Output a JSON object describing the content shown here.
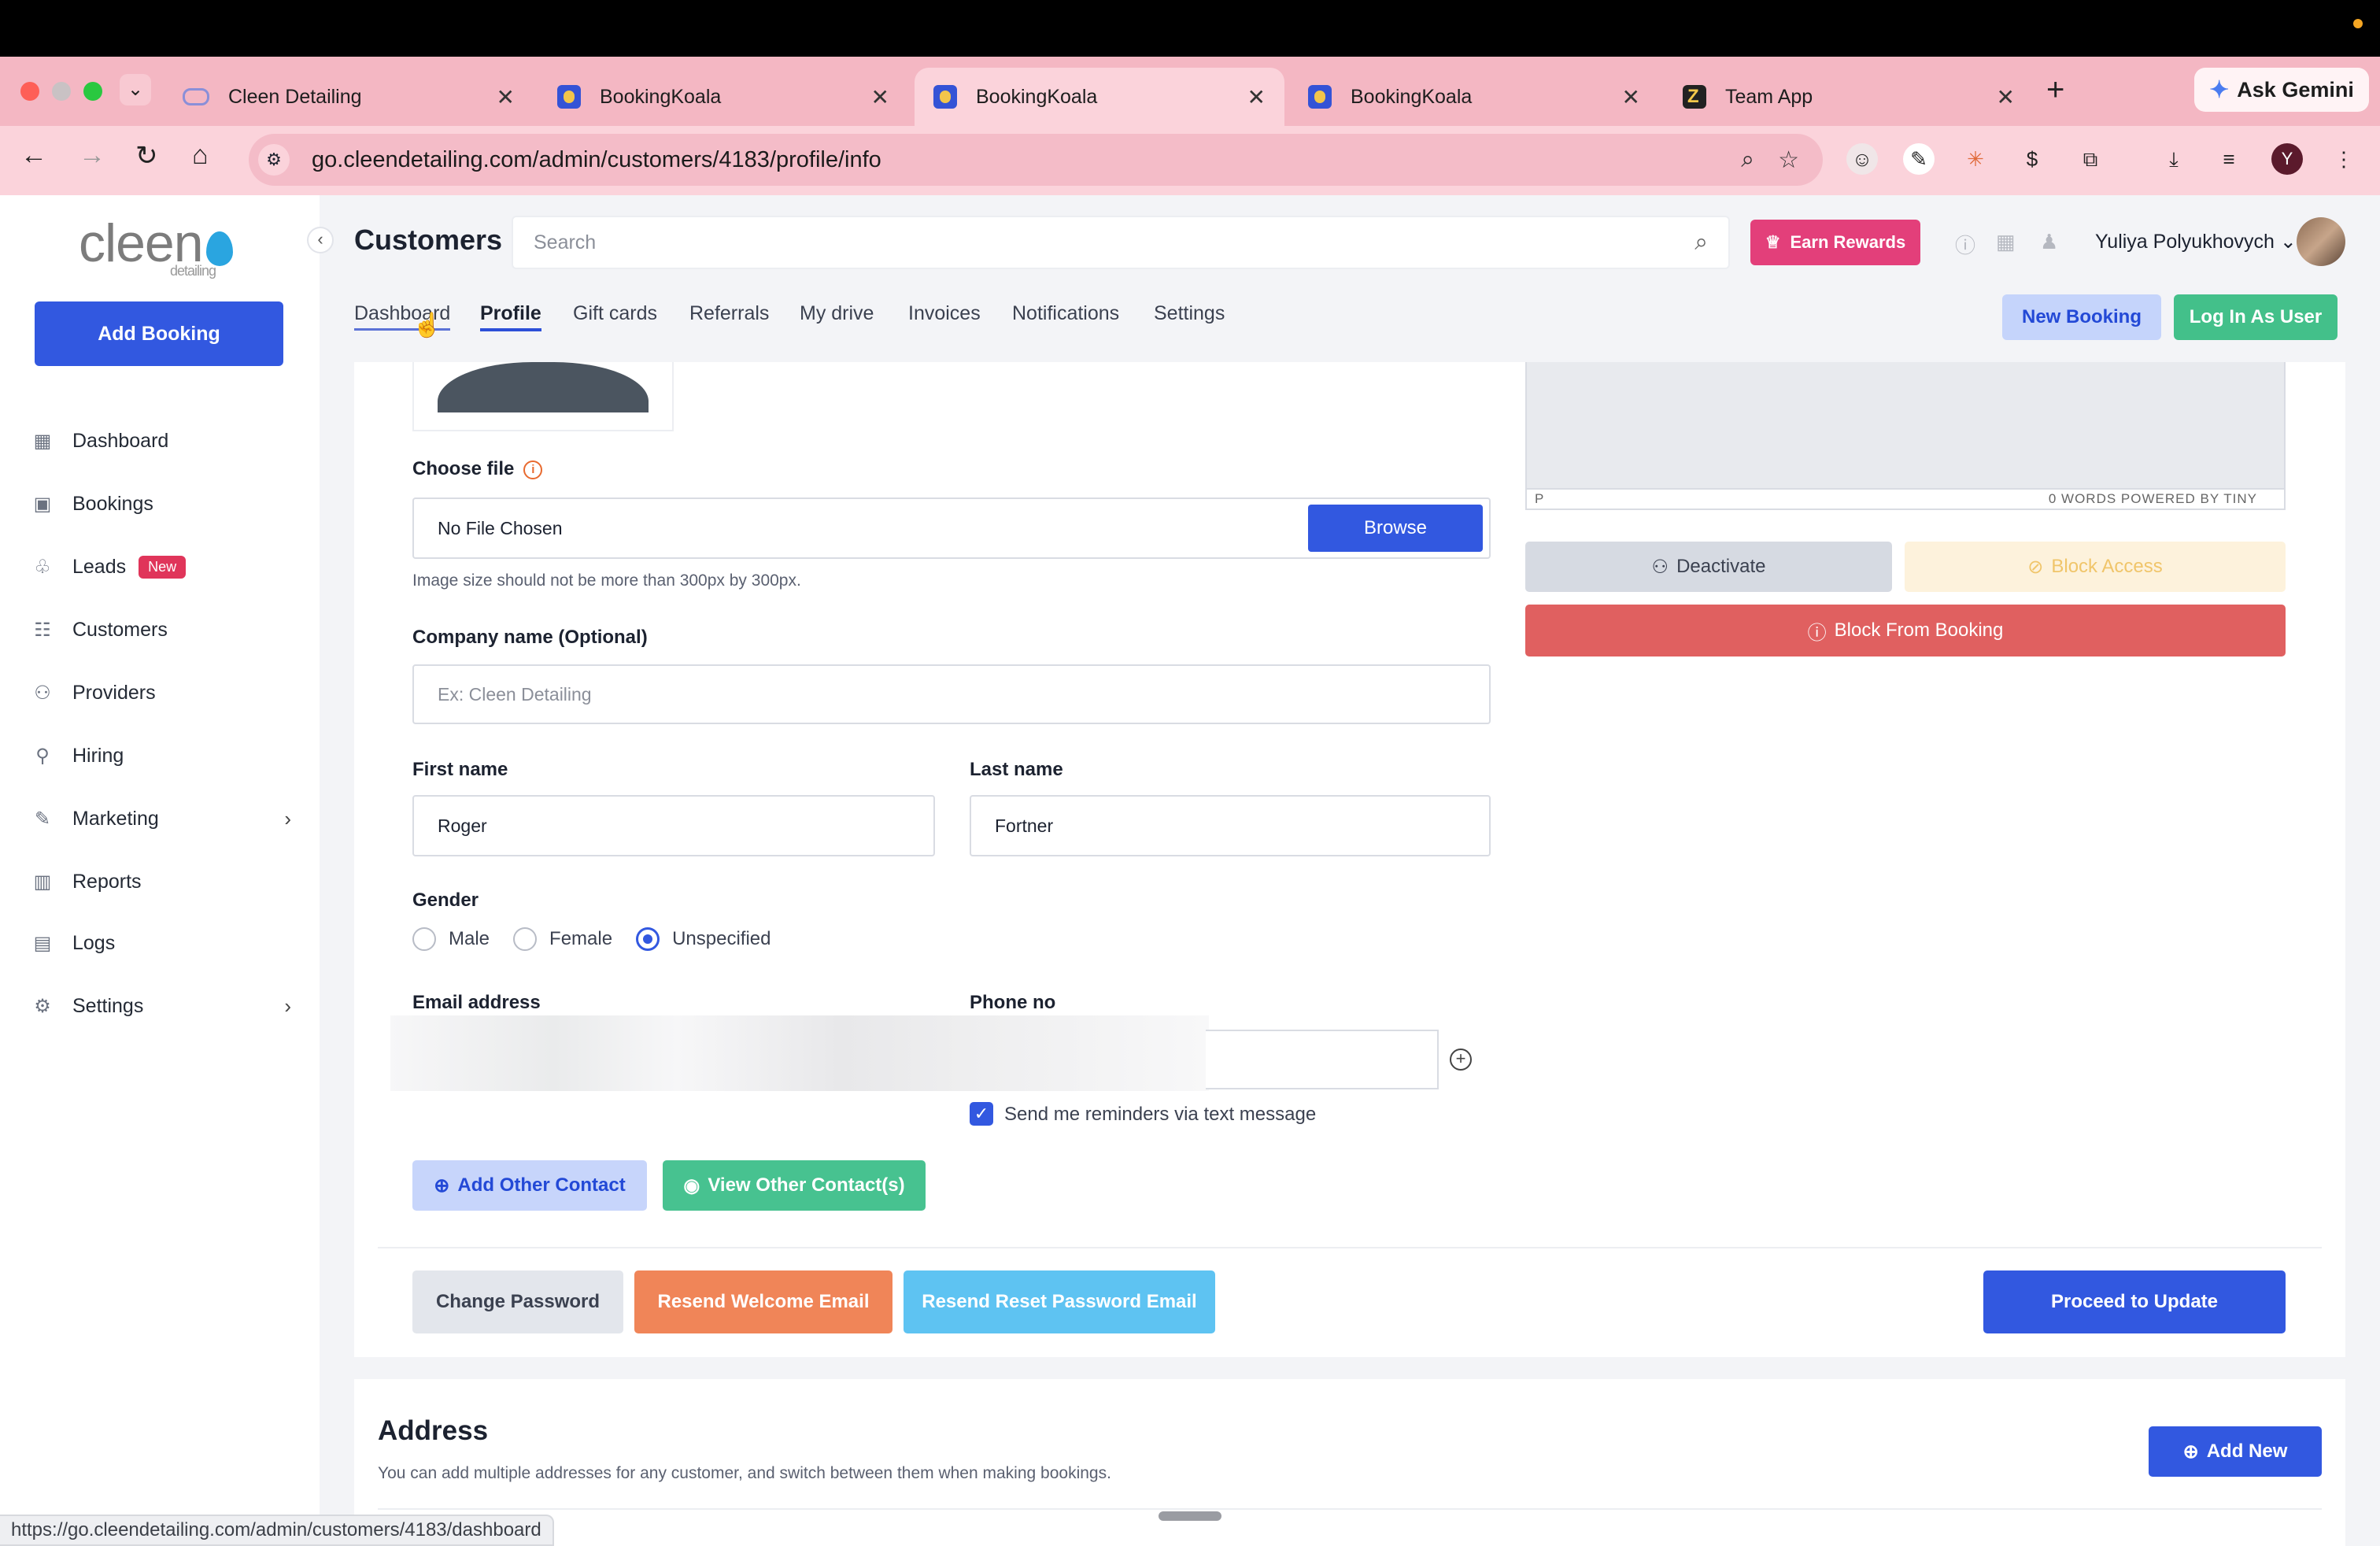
{
  "browser": {
    "tabs": [
      {
        "title": "Cleen Detailing",
        "active": false
      },
      {
        "title": "BookingKoala",
        "active": false
      },
      {
        "title": "BookingKoala",
        "active": true
      },
      {
        "title": "BookingKoala",
        "active": false
      },
      {
        "title": "Team App",
        "active": false
      }
    ],
    "close_glyph": "✕",
    "new_tab_glyph": "+",
    "gemini_label": "Ask Gemini",
    "url": "go.cleendetailing.com/admin/customers/4183/profile/info",
    "profile_initial": "Y",
    "status_url": "https://go.cleendetailing.com/admin/customers/4183/dashboard"
  },
  "sidebar": {
    "logo_text": "cleen",
    "logo_sub": "detailing",
    "add_booking": "Add Booking",
    "items": [
      {
        "label": "Dashboard",
        "icon": "dashboard-icon"
      },
      {
        "label": "Bookings",
        "icon": "calendar-icon"
      },
      {
        "label": "Leads",
        "icon": "bell-icon",
        "badge": "New"
      },
      {
        "label": "Customers",
        "icon": "users-icon"
      },
      {
        "label": "Providers",
        "icon": "provider-icon"
      },
      {
        "label": "Hiring",
        "icon": "hiring-icon"
      },
      {
        "label": "Marketing",
        "icon": "megaphone-icon",
        "has_children": true
      },
      {
        "label": "Reports",
        "icon": "chart-icon"
      },
      {
        "label": "Logs",
        "icon": "logs-icon"
      },
      {
        "label": "Settings",
        "icon": "gear-icon",
        "has_children": true
      }
    ]
  },
  "header": {
    "title": "Customers",
    "search_placeholder": "Search",
    "earn_rewards": "Earn Rewards",
    "user_name": "Yuliya Polyukhovych"
  },
  "subnav": {
    "tabs": [
      "Dashboard",
      "Profile",
      "Gift cards",
      "Referrals",
      "My drive",
      "Invoices",
      "Notifications",
      "Settings"
    ],
    "active": "Profile",
    "new_booking": "New Booking",
    "login_as_user": "Log In As User"
  },
  "profile_form": {
    "choose_file_label": "Choose file",
    "file_value": "No File Chosen",
    "browse": "Browse",
    "image_hint": "Image size should not be more than 300px by 300px.",
    "company_label": "Company name (Optional)",
    "company_placeholder": "Ex: Cleen Detailing",
    "first_name_label": "First name",
    "first_name": "Roger",
    "last_name_label": "Last name",
    "last_name": "Fortner",
    "gender_label": "Gender",
    "gender_options": [
      "Male",
      "Female",
      "Unspecified"
    ],
    "gender_selected": "Unspecified",
    "email_label": "Email address",
    "phone_label": "Phone no",
    "reminders_label": "Send me reminders via text message",
    "reminders_checked": true,
    "add_other_contact": "Add Other Contact",
    "view_other_contacts": "View Other Contact(s)",
    "change_password": "Change Password",
    "resend_welcome": "Resend Welcome Email",
    "resend_reset": "Resend Reset Password Email",
    "proceed": "Proceed to Update"
  },
  "right_panel": {
    "editor_path": "P",
    "editor_status": "0 WORDS  POWERED BY TINY",
    "deactivate": "Deactivate",
    "block_access": "Block Access",
    "block_booking": "Block From Booking"
  },
  "address": {
    "title": "Address",
    "description": "You can add multiple addresses for any customer, and switch between them when making bookings.",
    "add_new": "Add New"
  },
  "colors": {
    "primary": "#3258e0",
    "green": "#43c08a",
    "pink_chrome": "#f4b7c3",
    "danger": "#e06060",
    "orange": "#f08558",
    "cyan": "#5ec3f2"
  }
}
